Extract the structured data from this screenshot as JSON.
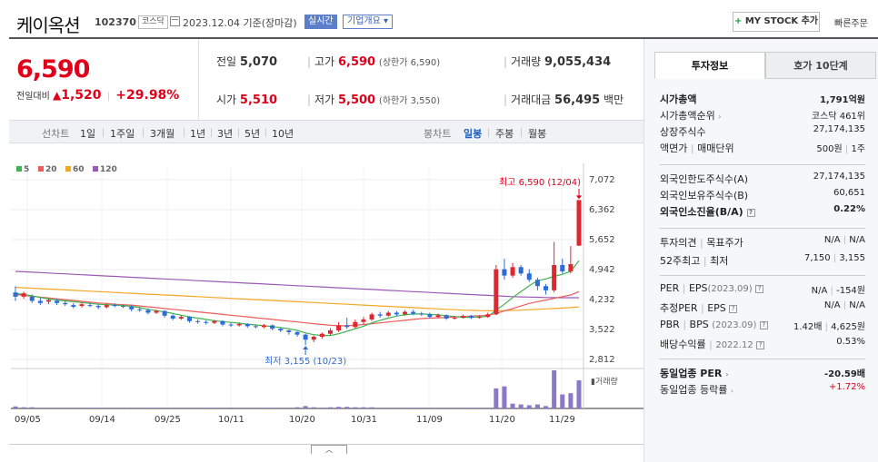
{
  "header": {
    "name": "케이옥션",
    "code": "102370",
    "market": "코스닥",
    "date": "2023.12.04 기준(장마감)",
    "realtime": "실시간",
    "company_overview": "기업개요",
    "my_stock": "MY STOCK 추가",
    "quick_order": "빠른주문"
  },
  "price": {
    "current": "6,590",
    "diff_label": "전일대비",
    "diff": "1,520",
    "rate": "+29.98%"
  },
  "quote": {
    "prev_label": "전일",
    "prev": "5,070",
    "high_label": "고가",
    "high": "6,590",
    "upper_limit": "(상한가 6,590)",
    "volume_label": "거래량",
    "volume": "9,055,434",
    "open_label": "시가",
    "open": "5,510",
    "low_label": "저가",
    "low": "5,500",
    "lower_limit": "(하한가 3,550)",
    "amount_label": "거래대금",
    "amount": "56,495",
    "amount_unit": "백만"
  },
  "periods": {
    "line_label": "선차트",
    "line_items": [
      "1일",
      "1주일",
      "3개월",
      "1년",
      "3년",
      "5년",
      "10년"
    ],
    "candle_label": "봉차트",
    "candle_items": [
      "일봉",
      "주봉",
      "월봉"
    ],
    "candle_selected": "일봉"
  },
  "chart_data": {
    "type": "candlestick",
    "legend": [
      "5",
      "20",
      "60",
      "120"
    ],
    "legend_colors": [
      "#3fb34f",
      "#ef5b5b",
      "#f5a623",
      "#9b59b6"
    ],
    "y_ticks": [
      "7,072",
      "6,362",
      "5,652",
      "4,942",
      "4,232",
      "3,522",
      "2,812"
    ],
    "ylim": [
      2812,
      7072
    ],
    "x_ticks": [
      "09/05",
      "09/14",
      "09/25",
      "10/11",
      "10/20",
      "10/31",
      "11/09",
      "11/20",
      "11/29"
    ],
    "high_annotation": "최고 6,590 (12/04)",
    "low_annotation": "최저 3,155 (10/23)",
    "volume_label": "거래량",
    "candles": [
      {
        "o": 4400,
        "c": 4300,
        "h": 4550,
        "l": 4200
      },
      {
        "o": 4300,
        "c": 4380,
        "h": 4420,
        "l": 4250
      },
      {
        "o": 4300,
        "c": 4200,
        "h": 4350,
        "l": 4150
      },
      {
        "o": 4200,
        "c": 4150,
        "h": 4280,
        "l": 4100
      },
      {
        "o": 4180,
        "c": 4220,
        "h": 4260,
        "l": 4120
      },
      {
        "o": 4200,
        "c": 4150,
        "h": 4250,
        "l": 4100
      },
      {
        "o": 4150,
        "c": 4120,
        "h": 4200,
        "l": 4080
      },
      {
        "o": 4100,
        "c": 4060,
        "h": 4150,
        "l": 4020
      },
      {
        "o": 4080,
        "c": 4120,
        "h": 4160,
        "l": 4040
      },
      {
        "o": 4100,
        "c": 4080,
        "h": 4150,
        "l": 4050
      },
      {
        "o": 4080,
        "c": 4050,
        "h": 4120,
        "l": 4000
      },
      {
        "o": 4050,
        "c": 4100,
        "h": 4130,
        "l": 4020
      },
      {
        "o": 4100,
        "c": 4080,
        "h": 4140,
        "l": 4050
      },
      {
        "o": 4080,
        "c": 4060,
        "h": 4110,
        "l": 4030
      },
      {
        "o": 4060,
        "c": 4000,
        "h": 4100,
        "l": 3950
      },
      {
        "o": 4000,
        "c": 3980,
        "h": 4050,
        "l": 3940
      },
      {
        "o": 3980,
        "c": 3920,
        "h": 4020,
        "l": 3880
      },
      {
        "o": 3920,
        "c": 3960,
        "h": 3990,
        "l": 3890
      },
      {
        "o": 3960,
        "c": 3850,
        "h": 3980,
        "l": 3800
      },
      {
        "o": 3850,
        "c": 3780,
        "h": 3880,
        "l": 3740
      },
      {
        "o": 3780,
        "c": 3820,
        "h": 3860,
        "l": 3750
      },
      {
        "o": 3820,
        "c": 3720,
        "h": 3840,
        "l": 3680
      },
      {
        "o": 3720,
        "c": 3700,
        "h": 3760,
        "l": 3660
      },
      {
        "o": 3700,
        "c": 3680,
        "h": 3740,
        "l": 3640
      },
      {
        "o": 3680,
        "c": 3720,
        "h": 3750,
        "l": 3650
      },
      {
        "o": 3720,
        "c": 3640,
        "h": 3740,
        "l": 3600
      },
      {
        "o": 3640,
        "c": 3620,
        "h": 3680,
        "l": 3580
      },
      {
        "o": 3620,
        "c": 3650,
        "h": 3690,
        "l": 3590
      },
      {
        "o": 3650,
        "c": 3600,
        "h": 3670,
        "l": 3560
      },
      {
        "o": 3600,
        "c": 3580,
        "h": 3640,
        "l": 3550
      },
      {
        "o": 3580,
        "c": 3620,
        "h": 3650,
        "l": 3550
      },
      {
        "o": 3620,
        "c": 3540,
        "h": 3640,
        "l": 3500
      },
      {
        "o": 3540,
        "c": 3500,
        "h": 3560,
        "l": 3460
      },
      {
        "o": 3500,
        "c": 3460,
        "h": 3520,
        "l": 3400
      },
      {
        "o": 3460,
        "c": 3400,
        "h": 3480,
        "l": 3350
      },
      {
        "o": 3400,
        "c": 3280,
        "h": 3420,
        "l": 3155
      },
      {
        "o": 3280,
        "c": 3350,
        "h": 3380,
        "l": 3220
      },
      {
        "o": 3350,
        "c": 3420,
        "h": 3450,
        "l": 3300
      },
      {
        "o": 3420,
        "c": 3500,
        "h": 3550,
        "l": 3380
      },
      {
        "o": 3500,
        "c": 3620,
        "h": 3700,
        "l": 3460
      },
      {
        "o": 3620,
        "c": 3580,
        "h": 3800,
        "l": 3540
      },
      {
        "o": 3580,
        "c": 3700,
        "h": 3760,
        "l": 3550
      },
      {
        "o": 3700,
        "c": 3760,
        "h": 3820,
        "l": 3650
      },
      {
        "o": 3760,
        "c": 3880,
        "h": 3920,
        "l": 3720
      },
      {
        "o": 3880,
        "c": 3850,
        "h": 3940,
        "l": 3800
      },
      {
        "o": 3850,
        "c": 3920,
        "h": 3960,
        "l": 3820
      },
      {
        "o": 3920,
        "c": 3880,
        "h": 3960,
        "l": 3840
      },
      {
        "o": 3880,
        "c": 3940,
        "h": 3980,
        "l": 3850
      },
      {
        "o": 3940,
        "c": 3900,
        "h": 3990,
        "l": 3860
      },
      {
        "o": 3900,
        "c": 3880,
        "h": 3940,
        "l": 3840
      },
      {
        "o": 3880,
        "c": 3820,
        "h": 3920,
        "l": 3780
      },
      {
        "o": 3820,
        "c": 3860,
        "h": 3900,
        "l": 3790
      },
      {
        "o": 3860,
        "c": 3780,
        "h": 3880,
        "l": 3750
      },
      {
        "o": 3780,
        "c": 3800,
        "h": 3840,
        "l": 3760
      },
      {
        "o": 3800,
        "c": 3840,
        "h": 3880,
        "l": 3780
      },
      {
        "o": 3840,
        "c": 3800,
        "h": 3870,
        "l": 3770
      },
      {
        "o": 3800,
        "c": 3820,
        "h": 3860,
        "l": 3780
      },
      {
        "o": 3820,
        "c": 3880,
        "h": 3920,
        "l": 3800
      },
      {
        "o": 3880,
        "c": 4950,
        "h": 5050,
        "l": 3860
      },
      {
        "o": 4950,
        "c": 4800,
        "h": 5200,
        "l": 4700
      },
      {
        "o": 4800,
        "c": 5000,
        "h": 5100,
        "l": 4750
      },
      {
        "o": 5000,
        "c": 4850,
        "h": 5050,
        "l": 4800
      },
      {
        "o": 4850,
        "c": 4700,
        "h": 4950,
        "l": 4650
      },
      {
        "o": 4700,
        "c": 4550,
        "h": 4750,
        "l": 4450
      },
      {
        "o": 4550,
        "c": 4450,
        "h": 4600,
        "l": 4350
      },
      {
        "o": 4450,
        "c": 5050,
        "h": 5600,
        "l": 4400
      },
      {
        "o": 5050,
        "c": 4900,
        "h": 5200,
        "l": 4850
      },
      {
        "o": 4900,
        "c": 5070,
        "h": 5500,
        "l": 4850
      },
      {
        "o": 5510,
        "c": 6590,
        "h": 6590,
        "l": 5500
      }
    ],
    "ma5": [
      4380,
      4350,
      4320,
      4280,
      4250,
      4220,
      4200,
      4180,
      4160,
      4140,
      4120,
      4110,
      4100,
      4090,
      4070,
      4040,
      4000,
      3970,
      3940,
      3900,
      3860,
      3820,
      3790,
      3760,
      3730,
      3710,
      3690,
      3670,
      3650,
      3630,
      3610,
      3590,
      3570,
      3540,
      3500,
      3440,
      3400,
      3380,
      3380,
      3420,
      3480,
      3540,
      3600,
      3680,
      3740,
      3790,
      3840,
      3870,
      3890,
      3890,
      3880,
      3870,
      3850,
      3830,
      3810,
      3810,
      3820,
      3830,
      3980,
      4120,
      4280,
      4420,
      4560,
      4680,
      4720,
      4780,
      4830,
      4900,
      5150
    ],
    "ma20": [
      4350,
      4330,
      4310,
      4290,
      4270,
      4250,
      4230,
      4210,
      4190,
      4170,
      4150,
      4140,
      4120,
      4110,
      4100,
      4080,
      4060,
      4040,
      4020,
      4000,
      3980,
      3960,
      3940,
      3920,
      3900,
      3880,
      3860,
      3840,
      3820,
      3800,
      3780,
      3760,
      3740,
      3720,
      3700,
      3680,
      3660,
      3640,
      3620,
      3610,
      3610,
      3620,
      3640,
      3660,
      3680,
      3700,
      3720,
      3740,
      3760,
      3780,
      3790,
      3800,
      3810,
      3820,
      3830,
      3840,
      3850,
      3860,
      3900,
      3960,
      4020,
      4080,
      4140,
      4180,
      4220,
      4260,
      4300,
      4340,
      4420
    ],
    "ma60": [
      4520,
      4510,
      4500,
      4490,
      4480,
      4470,
      4460,
      4450,
      4440,
      4430,
      4420,
      4410,
      4400,
      4390,
      4380,
      4370,
      4360,
      4350,
      4340,
      4330,
      4320,
      4310,
      4300,
      4290,
      4280,
      4270,
      4260,
      4250,
      4240,
      4230,
      4220,
      4210,
      4200,
      4190,
      4180,
      4170,
      4160,
      4150,
      4140,
      4130,
      4120,
      4110,
      4100,
      4090,
      4080,
      4070,
      4060,
      4050,
      4040,
      4030,
      4020,
      4010,
      4000,
      3990,
      3980,
      3975,
      3970,
      3965,
      3965,
      3970,
      3975,
      3980,
      3990,
      4000,
      4010,
      4020,
      4030,
      4040,
      4060
    ],
    "ma120": [
      4900,
      4890,
      4880,
      4870,
      4860,
      4850,
      4840,
      4830,
      4820,
      4810,
      4800,
      4790,
      4780,
      4770,
      4760,
      4750,
      4740,
      4730,
      4720,
      4710,
      4700,
      4690,
      4680,
      4670,
      4660,
      4650,
      4640,
      4630,
      4620,
      4610,
      4600,
      4590,
      4580,
      4570,
      4560,
      4550,
      4540,
      4530,
      4520,
      4510,
      4500,
      4490,
      4480,
      4470,
      4460,
      4450,
      4440,
      4430,
      4420,
      4410,
      4400,
      4390,
      4380,
      4370,
      4360,
      4350,
      4340,
      4330,
      4320,
      4310,
      4300,
      4295,
      4290,
      4285,
      4280,
      4278,
      4276,
      4275,
      4275
    ],
    "volumes": [
      0.05,
      0.03,
      0.03,
      0.02,
      0.02,
      0.02,
      0.02,
      0.02,
      0.02,
      0.02,
      0.02,
      0.02,
      0.02,
      0.02,
      0.02,
      0.02,
      0.02,
      0.02,
      0.02,
      0.02,
      0.02,
      0.02,
      0.02,
      0.02,
      0.02,
      0.02,
      0.02,
      0.02,
      0.02,
      0.02,
      0.02,
      0.02,
      0.02,
      0.02,
      0.03,
      0.06,
      0.03,
      0.02,
      0.03,
      0.04,
      0.04,
      0.03,
      0.03,
      0.03,
      0.02,
      0.02,
      0.02,
      0.02,
      0.02,
      0.02,
      0.02,
      0.02,
      0.02,
      0.02,
      0.02,
      0.02,
      0.02,
      0.02,
      0.5,
      0.55,
      0.12,
      0.1,
      0.08,
      0.1,
      0.06,
      0.95,
      0.35,
      0.38,
      0.7
    ]
  },
  "side": {
    "tab_invest": "투자정보",
    "tab_hoga": "호가 10단계",
    "market_cap_label": "시가총액",
    "market_cap": "1,791억원",
    "cap_rank_label": "시가총액순위",
    "cap_rank": "코스닥 461위",
    "shares_label": "상장주식수",
    "shares": "27,174,135",
    "par_label": "액면가",
    "unit_label": "매매단위",
    "par": "500원",
    "unit": "1주",
    "foreign_limit_label": "외국인한도주식수(A)",
    "foreign_limit": "27,174,135",
    "foreign_hold_label": "외국인보유주식수(B)",
    "foreign_hold": "60,651",
    "foreign_ratio_label": "외국인소진율(B/A)",
    "foreign_ratio": "0.22%",
    "opinion_label": "투자의견",
    "target_label": "목표주가",
    "opinion": "N/A",
    "target": "N/A",
    "week52_label": "52주최고",
    "week52_low_label": "최저",
    "week52_high": "7,150",
    "week52_low": "3,155",
    "per_label": "PER",
    "eps_label": "EPS",
    "eps_period": "(2023.09)",
    "per": "N/A",
    "eps": "-154원",
    "est_per_label": "추정PER",
    "est_eps_label": "EPS",
    "est_per": "N/A",
    "est_eps": "N/A",
    "pbr_label": "PBR",
    "bps_label": "BPS",
    "bps_period": "(2023.09)",
    "pbr": "1.42배",
    "bps": "4,625원",
    "div_label": "배당수익률",
    "div_period": "2022.12",
    "div": "0.53%",
    "sector_per_label": "동일업종 PER",
    "sector_per": "-20.59배",
    "sector_rate_label": "동일업종 등락률",
    "sector_rate": "+1.72%"
  }
}
